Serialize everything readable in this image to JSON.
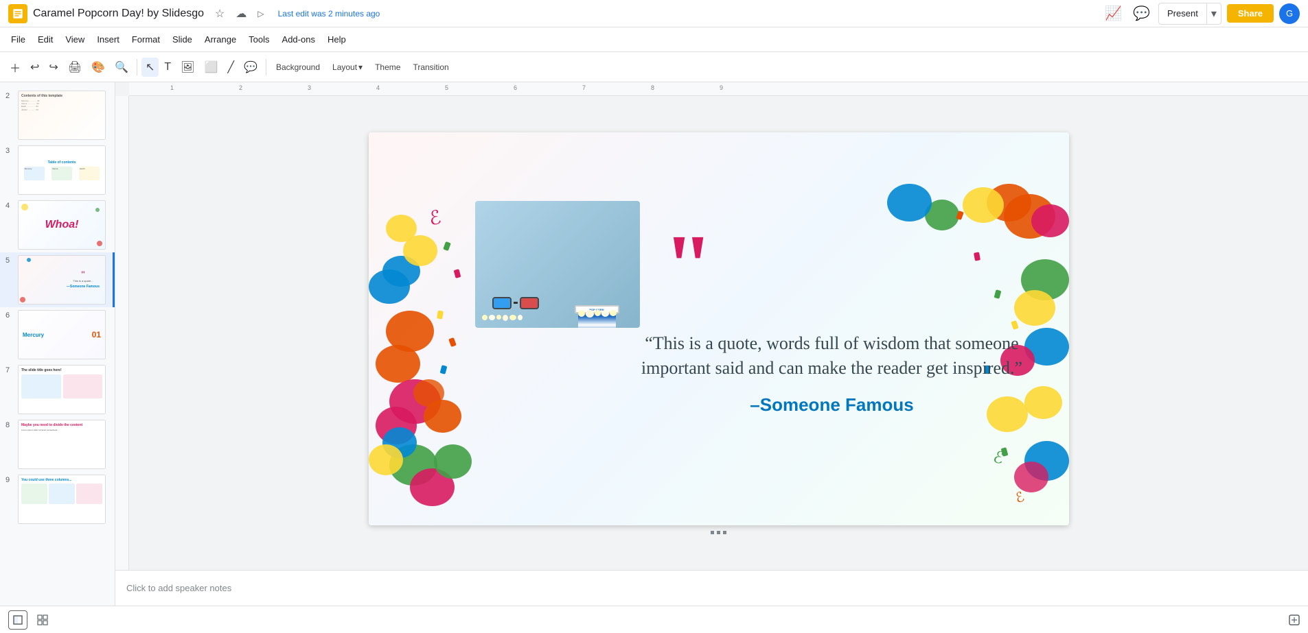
{
  "app": {
    "logo_color": "#F4B400",
    "title": "Caramel Popcorn Day! by Slidesgo",
    "last_edit": "Last edit was 2 minutes ago"
  },
  "top_bar": {
    "present_label": "Present",
    "share_label": "Share",
    "user_initial": "G"
  },
  "menu": {
    "items": [
      "File",
      "Edit",
      "View",
      "Insert",
      "Format",
      "Slide",
      "Arrange",
      "Tools",
      "Add-ons",
      "Help"
    ]
  },
  "toolbar": {
    "layout_label": "Layout",
    "theme_label": "Theme",
    "transition_label": "Transition",
    "background_label": "Background"
  },
  "slide": {
    "quote": "“This is a quote, words full of wisdom that someone important said and can make the reader get inspired.”",
    "attribution": "–Someone Famous",
    "big_quote_mark": "““"
  },
  "notes": {
    "placeholder": "Click to add speaker notes"
  },
  "slides_panel": {
    "slides": [
      {
        "number": "2",
        "label": "Contents slide"
      },
      {
        "number": "3",
        "label": "Table of contents"
      },
      {
        "number": "4",
        "label": "Whoa slide"
      },
      {
        "number": "5",
        "label": "Quote slide",
        "active": true
      },
      {
        "number": "6",
        "label": "Mercury slide"
      },
      {
        "number": "7",
        "label": "Slide title goes here"
      },
      {
        "number": "8",
        "label": "Divide content"
      },
      {
        "number": "9",
        "label": "Three columns"
      }
    ]
  },
  "colors": {
    "orange": "#E65100",
    "pink": "#D81B60",
    "blue": "#0288D1",
    "green": "#43A047",
    "yellow": "#FDD835",
    "red": "#E53935",
    "teal": "#00897B",
    "purple": "#7B1FA2"
  }
}
